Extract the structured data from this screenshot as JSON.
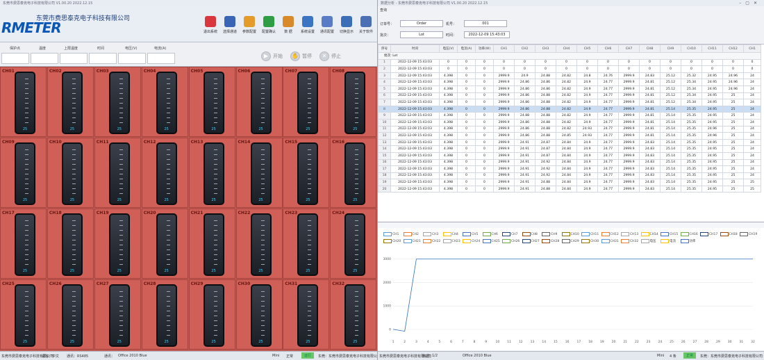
{
  "left_window": {
    "title": "东莞市费思泰克电子科技有限公司 V1.00.20 2022.12.15",
    "logo": "RMETER",
    "company": "东莞市费思泰克电子科技有限公司",
    "toolbar": [
      {
        "label": "退出系统",
        "icon": "close-circle-icon",
        "color": "#d9363e"
      },
      {
        "label": "选择通道",
        "icon": "cursor-icon",
        "color": "#3a64b5"
      },
      {
        "label": "参数配置",
        "icon": "user-config-icon",
        "color": "#e49b2a"
      },
      {
        "label": "配置确认",
        "icon": "check-circle-icon",
        "color": "#2e9e45"
      },
      {
        "label": "数 据",
        "icon": "user-data-icon",
        "color": "#d88a2b"
      },
      {
        "label": "系统设置",
        "icon": "gear-icon",
        "color": "#3b74c2"
      },
      {
        "label": "通讯配置",
        "icon": "document-icon",
        "color": "#5a7cc7"
      },
      {
        "label": "切换显示",
        "icon": "monitor-icon",
        "color": "#3a6fb8"
      },
      {
        "label": "关于软件",
        "icon": "info-doc-icon",
        "color": "#4b6fb5"
      }
    ],
    "control_labels": [
      "保护点",
      "温度",
      "上限温度",
      "时间",
      "电压(V)",
      "电流(A)"
    ],
    "controls": {
      "start": "开始",
      "pause": "暂停",
      "stop": "停止"
    },
    "cells": [
      {
        "id": "CH01",
        "value": "25"
      },
      {
        "id": "CH02",
        "value": "25"
      },
      {
        "id": "CH03",
        "value": "25"
      },
      {
        "id": "CH04",
        "value": "25"
      },
      {
        "id": "CH05",
        "value": "25"
      },
      {
        "id": "CH06",
        "value": "25"
      },
      {
        "id": "CH07",
        "value": "25"
      },
      {
        "id": "CH08",
        "value": "25"
      },
      {
        "id": "CH09",
        "value": "25"
      },
      {
        "id": "CH10",
        "value": "25"
      },
      {
        "id": "CH11",
        "value": "25"
      },
      {
        "id": "CH12",
        "value": "25"
      },
      {
        "id": "CH13",
        "value": "25"
      },
      {
        "id": "CH14",
        "value": "25"
      },
      {
        "id": "CH15",
        "value": "25"
      },
      {
        "id": "CH16",
        "value": "25"
      },
      {
        "id": "CH17",
        "value": "25"
      },
      {
        "id": "CH18",
        "value": "25"
      },
      {
        "id": "CH19",
        "value": "25"
      },
      {
        "id": "CH20",
        "value": "25"
      },
      {
        "id": "CH21",
        "value": "25"
      },
      {
        "id": "CH22",
        "value": "25"
      },
      {
        "id": "CH23",
        "value": "25"
      },
      {
        "id": "CH24",
        "value": "25"
      },
      {
        "id": "CH25",
        "value": "25"
      },
      {
        "id": "CH26",
        "value": "25"
      },
      {
        "id": "CH27",
        "value": "25"
      },
      {
        "id": "CH28",
        "value": "25"
      },
      {
        "id": "CH29",
        "value": "25"
      },
      {
        "id": "CH30",
        "value": "25"
      },
      {
        "id": "CH31",
        "value": "25"
      },
      {
        "id": "CH32",
        "value": "25"
      }
    ],
    "status": {
      "left": "东莞市费思泰克电子科技有限公司",
      "f1": "语言：中文",
      "f2": "通讯：RS485",
      "f3": "通讯：",
      "theme": "Office 2010 Blue",
      "mode": "Mini",
      "state": "正常",
      "ok": "运行",
      "tail": "东莞：东莞市费思泰克电子科技有限公司"
    }
  },
  "right_window": {
    "title": "数据分析 - 东莞市费思泰克电子科技有限公司 V1.00.20 2022.12.15",
    "section": "查询",
    "order_label": "订单号：",
    "order_value": "Order",
    "lot_label": "批次：",
    "lot_value": "Lot",
    "machine_label": "机号：",
    "machine_value": "001",
    "time_label": "时间：",
    "time_value": "2022-12-09 15:43:03",
    "columns": [
      "序号",
      "时间",
      "电压(V)",
      "电流(A)",
      "功率(W)",
      "CH1",
      "CH2",
      "CH3",
      "CH4",
      "CH5",
      "CH6",
      "CH7",
      "CH8",
      "CH9",
      "CH10",
      "CH11",
      "CH12",
      "CH1"
    ],
    "group_label": "批次: Lot",
    "rows": [
      [
        "1",
        "2022-12-09 15:43:03",
        "0",
        "0",
        "0",
        "0",
        "0",
        "0",
        "0",
        "0",
        "0",
        "0",
        "0",
        "0",
        "0",
        "0",
        "0",
        "0"
      ],
      [
        "2",
        "2022-12-09 15:43:03",
        "0",
        "0",
        "0",
        "0",
        "0",
        "0",
        "0",
        "0",
        "0",
        "0",
        "0",
        "0",
        "0",
        "0",
        "0",
        "0"
      ],
      [
        "3",
        "2022-12-09 15:43:03",
        "4.398",
        "0",
        "0",
        "2999.9",
        "24.9",
        "24.88",
        "24.82",
        "24.8",
        "24.76",
        "2999.9",
        "24.83",
        "25.12",
        "25.32",
        "24.95",
        "24.96",
        "24"
      ],
      [
        "4",
        "2022-12-09 15:43:03",
        "4.398",
        "0",
        "0",
        "2999.9",
        "24.86",
        "24.86",
        "24.82",
        "24.9",
        "24.77",
        "2999.9",
        "24.81",
        "25.12",
        "25.34",
        "24.95",
        "24.96",
        "24"
      ],
      [
        "5",
        "2022-12-09 15:43:03",
        "4.398",
        "0",
        "0",
        "2999.9",
        "24.86",
        "24.86",
        "24.82",
        "24.9",
        "24.77",
        "2999.9",
        "24.81",
        "25.12",
        "25.34",
        "24.95",
        "24.96",
        "24"
      ],
      [
        "6",
        "2022-12-09 15:43:03",
        "4.398",
        "0",
        "0",
        "2999.9",
        "24.86",
        "24.88",
        "24.82",
        "24.9",
        "24.77",
        "2999.9",
        "24.81",
        "25.12",
        "25.34",
        "24.95",
        "25",
        "24"
      ],
      [
        "7",
        "2022-12-09 15:43:03",
        "4.398",
        "0",
        "0",
        "2999.9",
        "24.86",
        "24.88",
        "24.82",
        "24.9",
        "24.77",
        "2999.9",
        "24.81",
        "25.12",
        "25.34",
        "24.95",
        "25",
        "24"
      ],
      [
        "8",
        "2022-12-09 15:43:03",
        "4.398",
        "0",
        "0",
        "2999.9",
        "24.86",
        "24.88",
        "24.82",
        "24.9",
        "24.77",
        "2999.9",
        "24.81",
        "25.14",
        "25.35",
        "24.95",
        "25",
        "24"
      ],
      [
        "9",
        "2022-12-09 15:43:03",
        "4.398",
        "0",
        "0",
        "2999.9",
        "24.88",
        "24.88",
        "24.82",
        "24.9",
        "24.77",
        "2999.9",
        "24.81",
        "25.14",
        "25.35",
        "24.95",
        "25",
        "24"
      ],
      [
        "10",
        "2022-12-09 15:43:03",
        "4.398",
        "0",
        "0",
        "2999.9",
        "24.86",
        "24.88",
        "24.82",
        "24.9",
        "24.77",
        "2999.9",
        "24.81",
        "25.14",
        "25.35",
        "24.95",
        "25",
        "24"
      ],
      [
        "11",
        "2022-12-09 15:43:03",
        "4.398",
        "0",
        "0",
        "2999.9",
        "24.86",
        "24.88",
        "24.82",
        "24.93",
        "24.77",
        "2999.9",
        "24.81",
        "25.14",
        "25.35",
        "24.96",
        "25",
        "24"
      ],
      [
        "12",
        "2022-12-09 15:43:03",
        "4.398",
        "0",
        "0",
        "2999.9",
        "24.86",
        "24.88",
        "24.85",
        "24.93",
        "24.77",
        "2999.9",
        "24.81",
        "25.14",
        "25.35",
        "24.96",
        "25",
        "24"
      ],
      [
        "13",
        "2022-12-09 15:43:03",
        "4.398",
        "0",
        "0",
        "2999.9",
        "24.91",
        "24.87",
        "24.84",
        "24.9",
        "24.77",
        "2999.9",
        "24.83",
        "25.14",
        "25.35",
        "24.95",
        "25",
        "24"
      ],
      [
        "14",
        "2022-12-09 15:43:03",
        "4.398",
        "0",
        "0",
        "2999.9",
        "24.91",
        "24.87",
        "24.84",
        "24.9",
        "24.77",
        "2999.9",
        "24.83",
        "25.14",
        "25.35",
        "24.95",
        "25",
        "24"
      ],
      [
        "15",
        "2022-12-09 15:43:03",
        "4.398",
        "0",
        "0",
        "2999.9",
        "24.91",
        "24.87",
        "24.84",
        "24.9",
        "24.77",
        "2999.9",
        "24.83",
        "25.14",
        "25.35",
        "24.95",
        "25",
        "24"
      ],
      [
        "16",
        "2022-12-09 15:43:03",
        "4.398",
        "0",
        "0",
        "2999.9",
        "24.91",
        "24.92",
        "24.84",
        "24.9",
        "24.77",
        "2999.9",
        "24.83",
        "25.14",
        "25.35",
        "24.95",
        "25",
        "24"
      ],
      [
        "17",
        "2022-12-09 15:43:03",
        "4.398",
        "0",
        "0",
        "2999.9",
        "24.91",
        "24.92",
        "24.84",
        "24.9",
        "24.77",
        "2999.9",
        "24.83",
        "25.14",
        "25.35",
        "24.95",
        "25",
        "24"
      ],
      [
        "18",
        "2022-12-09 15:43:03",
        "4.398",
        "0",
        "0",
        "2999.9",
        "24.91",
        "24.92",
        "24.84",
        "24.9",
        "24.77",
        "2999.9",
        "24.83",
        "25.14",
        "25.35",
        "24.95",
        "25",
        "24"
      ],
      [
        "19",
        "2022-12-09 15:43:03",
        "4.398",
        "0",
        "0",
        "2999.9",
        "24.91",
        "24.88",
        "24.84",
        "24.9",
        "24.77",
        "2999.9",
        "24.83",
        "25.14",
        "25.35",
        "24.95",
        "25",
        "25"
      ],
      [
        "20",
        "2022-12-09 15:43:03",
        "4.398",
        "0",
        "0",
        "2999.9",
        "24.91",
        "24.88",
        "24.84",
        "24.9",
        "24.77",
        "2999.9",
        "24.83",
        "25.14",
        "25.35",
        "24.95",
        "25",
        "25"
      ]
    ],
    "legend": [
      "CH1",
      "CH2",
      "CH3",
      "CH4",
      "CH5",
      "CH6",
      "CH7",
      "CH8",
      "CH9",
      "CH10",
      "CH11",
      "CH12",
      "CH13",
      "CH14",
      "CH15",
      "CH16",
      "CH17",
      "CH18",
      "CH19",
      "CH20",
      "CH21",
      "CH22",
      "CH23",
      "CH24",
      "CH25",
      "CH26",
      "CH27",
      "CH28",
      "CH29",
      "CH30",
      "CH31",
      "CH32",
      "电压",
      "电流",
      "功率"
    ],
    "legend_colors": [
      "#5b9bd5",
      "#ed7d31",
      "#a5a5a5",
      "#ffc000",
      "#4472c4",
      "#70ad47",
      "#264478",
      "#9e480e",
      "#636363",
      "#997300"
    ],
    "status": {
      "left": "东莞市费思泰克电子科技有限公司",
      "page_label": "数据：",
      "page": "1/2",
      "theme": "Office 2010 Blue",
      "mode": "Mini",
      "rows": "4 条",
      "ok": "正常",
      "tail": "东莞：东莞市费思泰克电子科技有限公司"
    }
  },
  "chart_data": {
    "type": "line",
    "title": "",
    "xlabel": "",
    "ylabel": "",
    "x": [
      1,
      2,
      3,
      4,
      5,
      6,
      7,
      8,
      9,
      10,
      11,
      12,
      13,
      14,
      15,
      16,
      17,
      18,
      19,
      20,
      21,
      22,
      23,
      24,
      25,
      26,
      27,
      28,
      29,
      30,
      31,
      32
    ],
    "series": [
      {
        "values": [
          0,
          -80,
          3000,
          3000,
          2999.9,
          2999.9,
          2999.9,
          2999.9,
          2999.9,
          2999.9,
          2999.9,
          2999.9,
          2999.9,
          2999.9,
          2999.9,
          2999.9,
          2999.9,
          2999.9,
          2999.9,
          2999.9,
          2999.9,
          2999.9,
          2999.9,
          2999.9,
          2999.9,
          2999.9,
          2999.9,
          2999.9,
          2999.9,
          2999.9,
          2999.9,
          2999.9
        ]
      }
    ],
    "y_ticks": [
      "3000",
      "2000",
      "1000",
      "0"
    ],
    "x_ticks": [
      "1",
      "2",
      "3",
      "4",
      "5",
      "6",
      "7",
      "8",
      "9",
      "10",
      "11",
      "12",
      "13",
      "14",
      "15",
      "16",
      "17",
      "18",
      "19",
      "20",
      "21",
      "22",
      "23",
      "24",
      "25",
      "26",
      "27",
      "28",
      "29",
      "30",
      "31",
      "32"
    ],
    "ylim": [
      -300,
      3200
    ],
    "line_color": "#2a6fba",
    "grid": true
  }
}
